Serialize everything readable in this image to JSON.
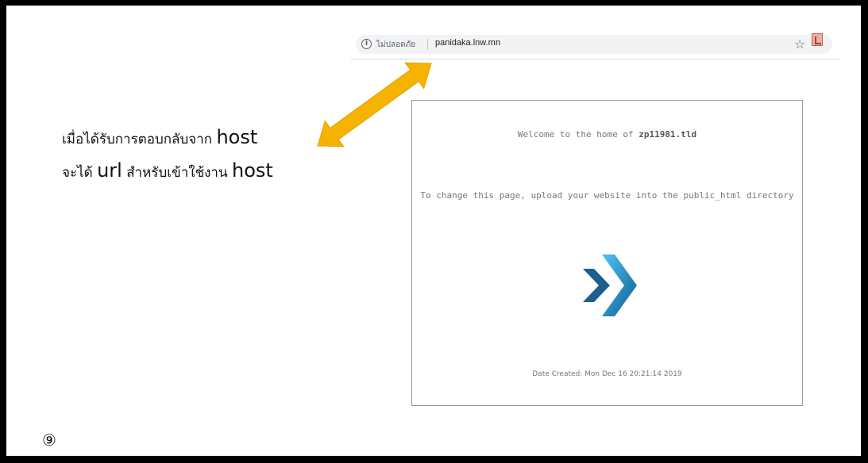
{
  "browser": {
    "security_label": "ไม่ปลอดภัย",
    "url": "panidaka.lnw.mn",
    "info_glyph": "i",
    "star_glyph": "☆"
  },
  "caption": {
    "line1_thai": "เมื่อได้รับการตอบกลับจาก ",
    "line1_host": "host",
    "line2_thai_a": "จะได้ ",
    "line2_url": "url",
    "line2_thai_b": " สำหรับเข้าใช้งาน ",
    "line2_host": "host"
  },
  "arrow": {
    "color": "#f5b300",
    "type": "double-headed"
  },
  "hosted_page": {
    "welcome_prefix": "Welcome to the home of ",
    "domain": "zp11981.tld",
    "instruction": "To change this page, upload your website into the public_html directory",
    "date_created": "Date Created: Mon Dec 16 20:21:14 2019",
    "logo_color": "#1a8fc9"
  },
  "slide": {
    "number": "⑨"
  }
}
